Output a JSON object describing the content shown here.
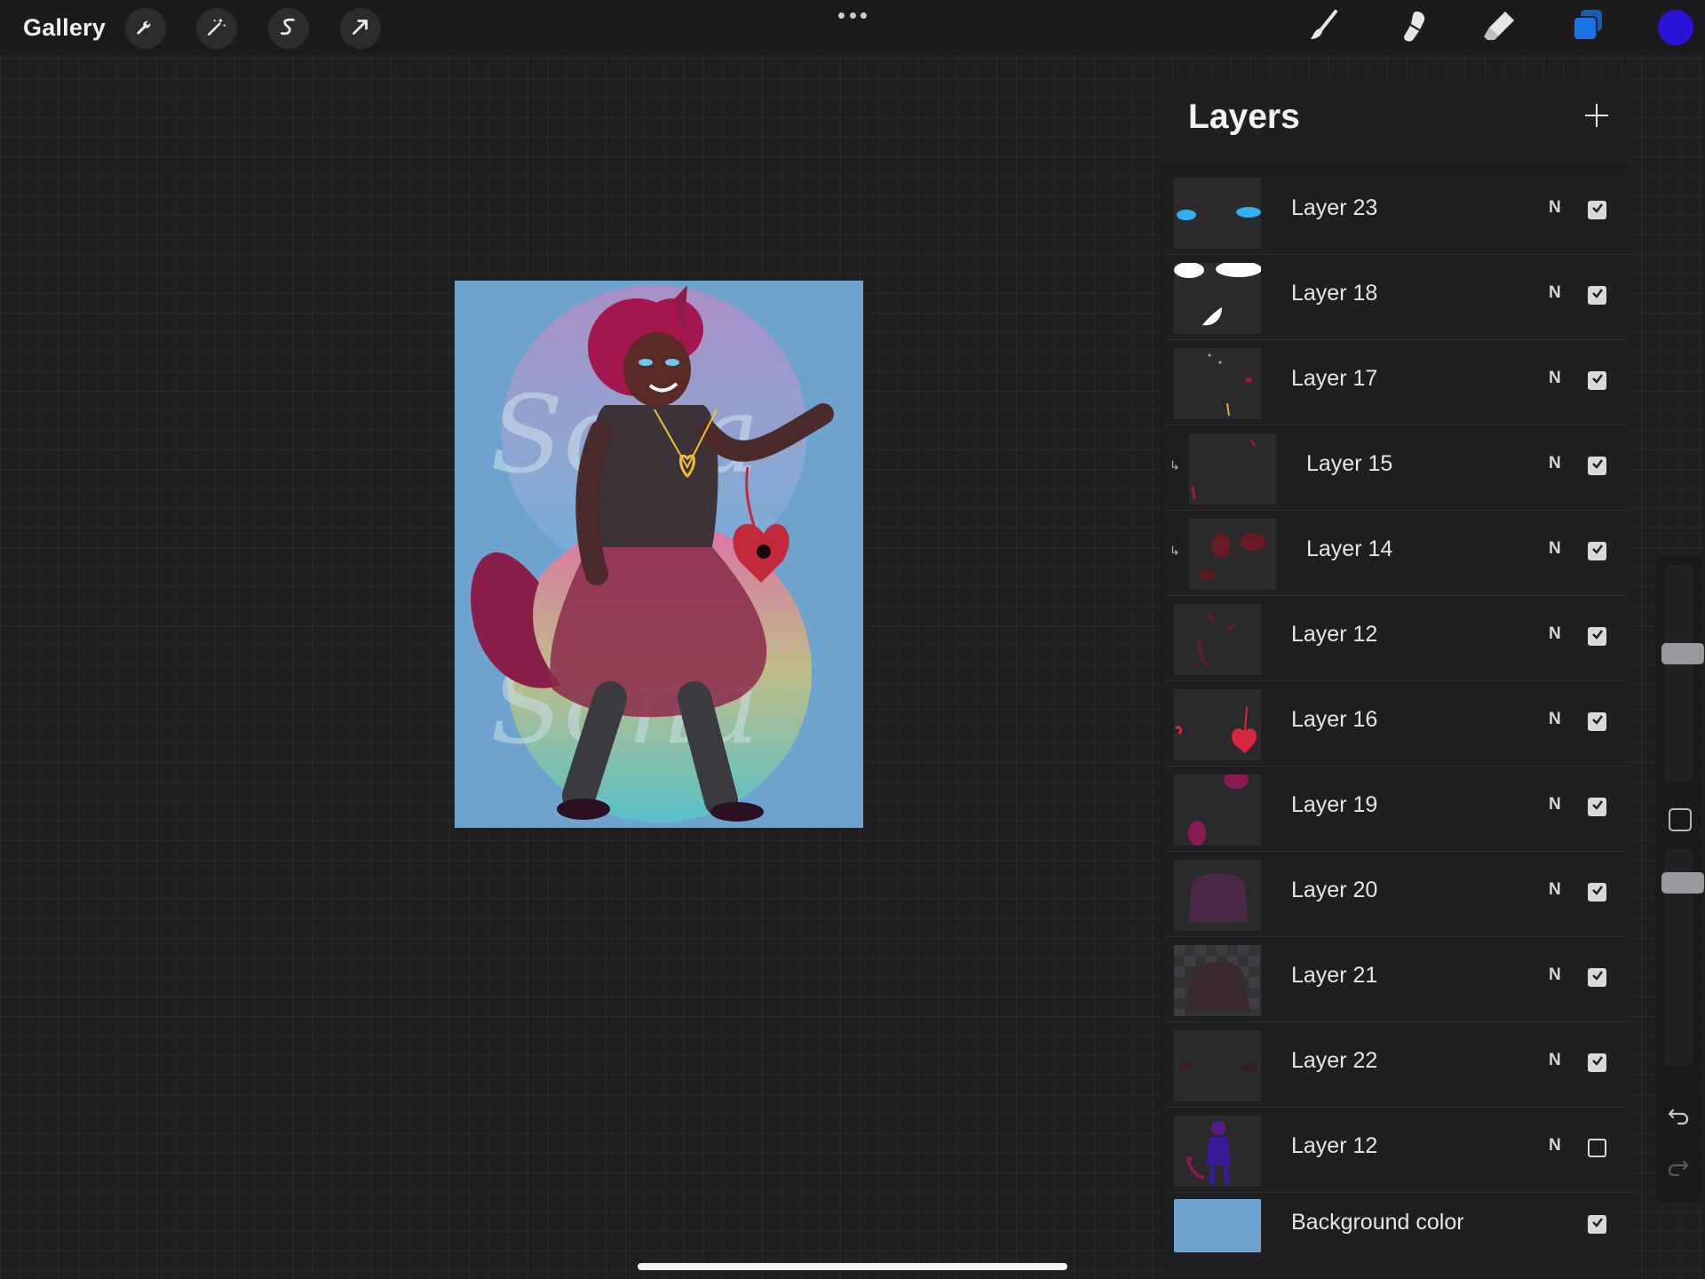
{
  "toolbar": {
    "gallery_label": "Gallery",
    "left_tools": [
      "wrench-icon",
      "magic-wand-icon",
      "selection-s-icon",
      "transform-arrow-icon"
    ],
    "right_tools": [
      "brush-icon",
      "smudge-icon",
      "eraser-icon",
      "layers-icon"
    ],
    "active_color": "#2a12d6",
    "layers_icon_color": "#1a73e8"
  },
  "layers_panel": {
    "title": "Layers",
    "add_icon": "plus-icon",
    "layers": [
      {
        "name": "Layer 23",
        "blend": "N",
        "visible": true,
        "clipped": false
      },
      {
        "name": "Layer 18",
        "blend": "N",
        "visible": true,
        "clipped": false
      },
      {
        "name": "Layer 17",
        "blend": "N",
        "visible": true,
        "clipped": false
      },
      {
        "name": "Layer 15",
        "blend": "N",
        "visible": true,
        "clipped": true
      },
      {
        "name": "Layer 14",
        "blend": "N",
        "visible": true,
        "clipped": true
      },
      {
        "name": "Layer 12",
        "blend": "N",
        "visible": true,
        "clipped": false
      },
      {
        "name": "Layer 16",
        "blend": "N",
        "visible": true,
        "clipped": false
      },
      {
        "name": "Layer 19",
        "blend": "N",
        "visible": true,
        "clipped": false
      },
      {
        "name": "Layer 20",
        "blend": "N",
        "visible": true,
        "clipped": false
      },
      {
        "name": "Layer 21",
        "blend": "N",
        "visible": true,
        "clipped": false
      },
      {
        "name": "Layer 22",
        "blend": "N",
        "visible": true,
        "clipped": false
      },
      {
        "name": "Layer 12",
        "blend": "N",
        "visible": false,
        "clipped": false
      }
    ],
    "background": {
      "name": "Background color",
      "visible": true,
      "color": "#6fa3cf"
    }
  },
  "canvas": {
    "background_color": "#6fa3cf",
    "watermark_text": [
      "Sona",
      "Sona"
    ]
  }
}
